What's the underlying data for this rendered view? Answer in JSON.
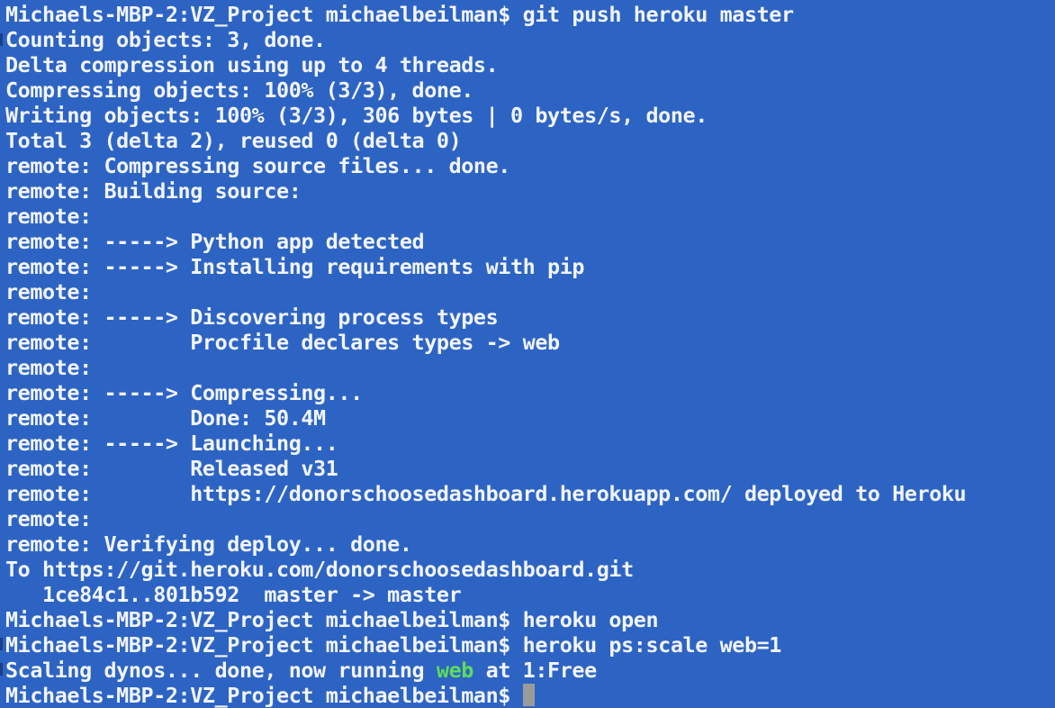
{
  "terminal": {
    "lines": [
      "Michaels-MBP-2:VZ_Project michaelbeilman$ git push heroku master",
      "Counting objects: 3, done.",
      "Delta compression using up to 4 threads.",
      "Compressing objects: 100% (3/3), done.",
      "Writing objects: 100% (3/3), 306 bytes | 0 bytes/s, done.",
      "Total 3 (delta 2), reused 0 (delta 0)",
      "remote: Compressing source files... done.",
      "remote: Building source:",
      "remote:",
      "remote: -----> Python app detected",
      "remote: -----> Installing requirements with pip",
      "remote:",
      "remote: -----> Discovering process types",
      "remote:        Procfile declares types -> web",
      "remote:",
      "remote: -----> Compressing...",
      "remote:        Done: 50.4M",
      "remote: -----> Launching...",
      "remote:        Released v31",
      "remote:        https://donorschoosedashboard.herokuapp.com/ deployed to Heroku",
      "remote:",
      "remote: Verifying deploy... done.",
      "To https://git.heroku.com/donorschoosedashboard.git",
      "   1ce84c1..801b592  master -> master",
      "Michaels-MBP-2:VZ_Project michaelbeilman$ heroku open",
      "Michaels-MBP-2:VZ_Project michaelbeilman$ heroku ps:scale web=1"
    ],
    "scaling_line": {
      "prefix": "Scaling dynos... done, now running ",
      "highlight": "web",
      "suffix": " at 1:Free"
    },
    "prompt": "Michaels-MBP-2:VZ_Project michaelbeilman$ ",
    "colors": {
      "background": "#2d64c4",
      "text": "#f2f5fa",
      "highlight": "#5ddc5d",
      "cursor": "#9a9a9a"
    }
  }
}
